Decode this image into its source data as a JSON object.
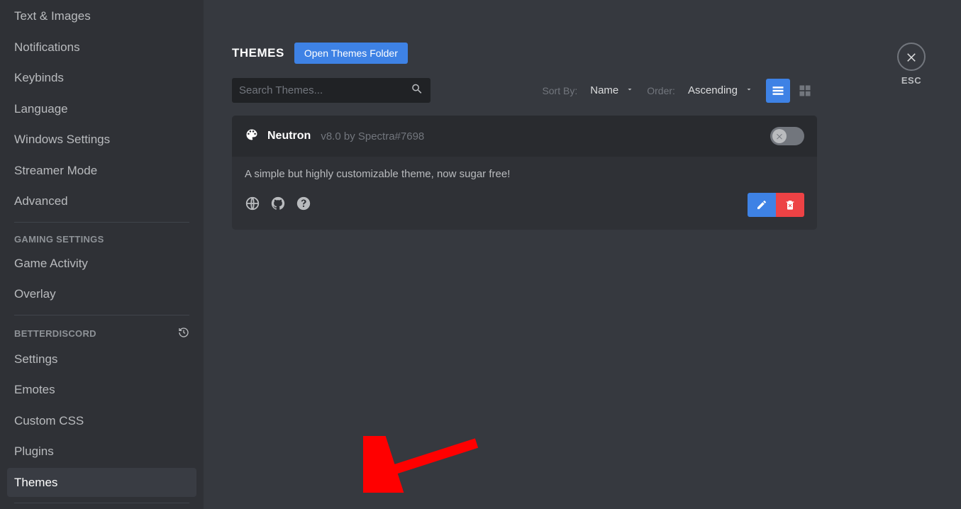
{
  "sidebar": {
    "appSettings": [
      "Text & Images",
      "Notifications",
      "Keybinds",
      "Language",
      "Windows Settings",
      "Streamer Mode",
      "Advanced"
    ],
    "gamingHeader": "Gaming Settings",
    "gaming": [
      "Game Activity",
      "Overlay"
    ],
    "bdHeader": "BetterDiscord",
    "bd": [
      "Settings",
      "Emotes",
      "Custom CSS",
      "Plugins",
      "Themes"
    ]
  },
  "close": {
    "label": "ESC"
  },
  "header": {
    "title": "THEMES",
    "openFolder": "Open Themes Folder"
  },
  "toolbar": {
    "searchPlaceholder": "Search Themes...",
    "sortByLabel": "Sort By:",
    "sortByValue": "Name",
    "orderLabel": "Order:",
    "orderValue": "Ascending"
  },
  "theme": {
    "name": "Neutron",
    "meta": "v8.0 by Spectra#7698",
    "desc": "A simple but highly customizable theme, now sugar free!"
  }
}
